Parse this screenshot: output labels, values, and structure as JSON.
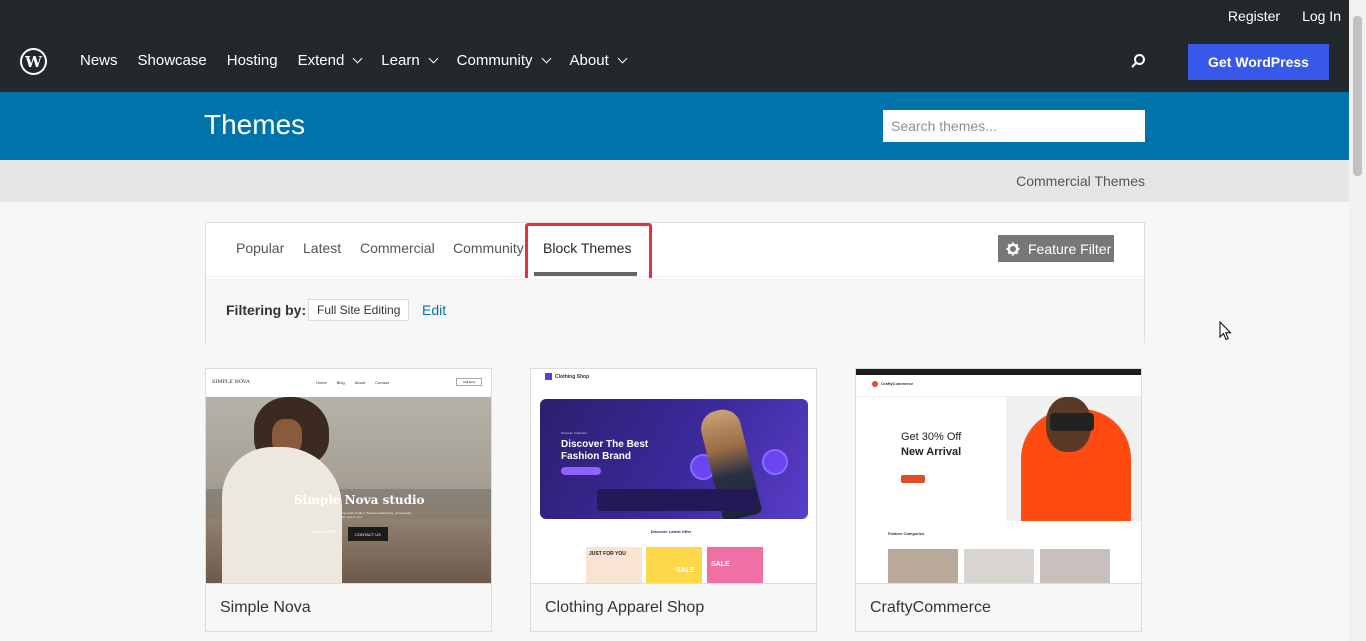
{
  "top_links": {
    "register": "Register",
    "login": "Log In"
  },
  "nav": [
    {
      "label": "News",
      "dropdown": false
    },
    {
      "label": "Showcase",
      "dropdown": false
    },
    {
      "label": "Hosting",
      "dropdown": false
    },
    {
      "label": "Extend",
      "dropdown": true
    },
    {
      "label": "Learn",
      "dropdown": true
    },
    {
      "label": "Community",
      "dropdown": true
    },
    {
      "label": "About",
      "dropdown": true
    }
  ],
  "get_wp": "Get WordPress",
  "header": {
    "title": "Themes",
    "search_placeholder": "Search themes..."
  },
  "commercial_link": "Commercial Themes",
  "tabs": [
    "Popular",
    "Latest",
    "Commercial",
    "Community",
    "Block Themes"
  ],
  "active_tab": "Block Themes",
  "feature_filter": "Feature Filter",
  "filtering": {
    "label": "Filtering by:",
    "chip": "Full Site Editing",
    "edit": "Edit"
  },
  "themes": [
    {
      "name": "Simple Nova",
      "preview": {
        "brand": "SIMPLE NOVA",
        "menu": [
          "Home",
          "Blog",
          "About",
          "Contact"
        ],
        "button": "Call Now",
        "title": "Simple Nova studio",
        "subtitle": "Lorem your audience! Interested opens a top-notch studio in Brooklyn Hairstyling, photography, art, skin care to you.",
        "btn1": "LEARN MORE",
        "btn2": "CONTACT US"
      }
    },
    {
      "name": "Clothing Apparel Shop",
      "preview": {
        "brand": "Clothing Shop",
        "tag": "Premium Collection",
        "title_l1": "Discover The Best",
        "title_l2": "Fashion Brand",
        "offer": "Discover Latest Offer",
        "sale1": "JUST FOR YOU",
        "sale2": "SALE",
        "sale3": "SALE"
      }
    },
    {
      "name": "CraftyCommerce",
      "preview": {
        "brand": "CraftyCommerce",
        "h1": "Get 30% Off",
        "h2": "New Arrival",
        "categories": "Feature Categories"
      }
    }
  ]
}
